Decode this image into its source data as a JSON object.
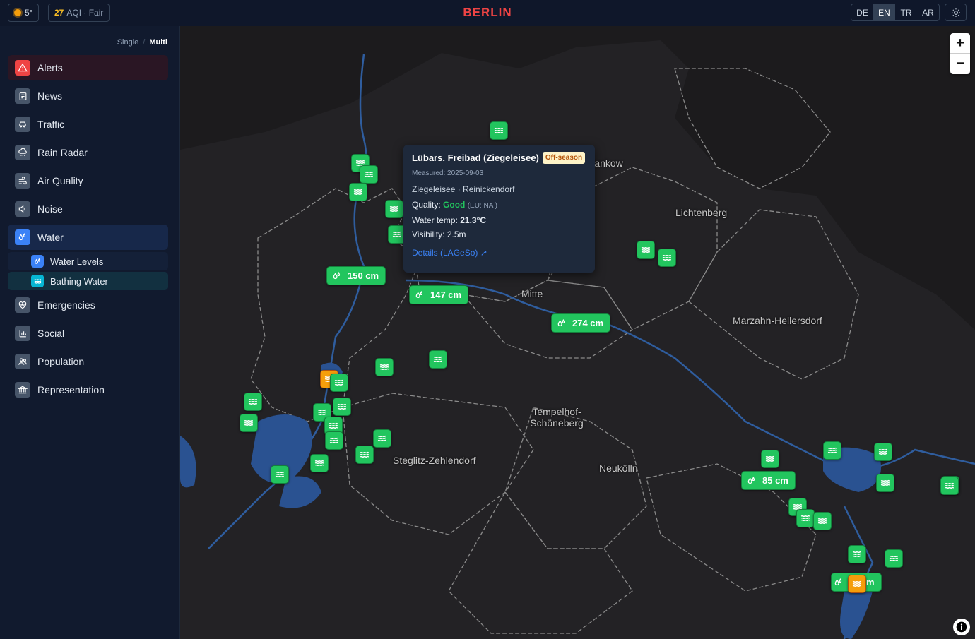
{
  "topbar": {
    "temperature": "5°",
    "aqi_value": "27",
    "aqi_label": "AQI · Fair",
    "city": "BERLIN",
    "languages": [
      "DE",
      "EN",
      "TR",
      "AR"
    ],
    "active_language": "EN"
  },
  "sidebar": {
    "mode_single": "Single",
    "mode_multi": "Multi",
    "items": [
      {
        "label": "Alerts",
        "icon": "warning-icon"
      },
      {
        "label": "News",
        "icon": "newspaper-icon"
      },
      {
        "label": "Traffic",
        "icon": "car-icon"
      },
      {
        "label": "Rain Radar",
        "icon": "cloud-rain-icon"
      },
      {
        "label": "Air Quality",
        "icon": "wind-icon"
      },
      {
        "label": "Noise",
        "icon": "speaker-icon"
      },
      {
        "label": "Water",
        "icon": "droplets-icon"
      },
      {
        "label": "Emergencies",
        "icon": "heart-pulse-icon"
      },
      {
        "label": "Social",
        "icon": "bar-chart-icon"
      },
      {
        "label": "Population",
        "icon": "users-icon"
      },
      {
        "label": "Representation",
        "icon": "landmark-icon"
      }
    ],
    "water_subitems": [
      {
        "label": "Water Levels",
        "icon": "droplets-icon"
      },
      {
        "label": "Bathing Water",
        "icon": "waves-icon"
      }
    ]
  },
  "map": {
    "districts": [
      "Pankow",
      "Lichtenberg",
      "Mitte",
      "Marzahn-Hellersdorf",
      "Tempelhof-Schöneberg",
      "Steglitz-Zehlendorf",
      "Neukölln"
    ],
    "water_levels": [
      "150 cm",
      "147 cm",
      "274 cm",
      "85 cm"
    ],
    "partial_level_text": "m"
  },
  "popup": {
    "title": "Lübars. Freibad (Ziegeleisee)",
    "badge": "Off-season",
    "measured": "Measured: 2025-09-03",
    "location": "Ziegeleisee · Reinickendorf",
    "quality_label": "Quality:",
    "quality_value": "Good",
    "quality_eu": "(EU: NA )",
    "water_temp_label": "Water temp:",
    "water_temp_value": "21.3°C",
    "visibility_label": "Visibility:",
    "visibility_value": "2.5m",
    "details_link": "Details (LAGeSo) ↗"
  },
  "colors": {
    "accent_red": "#ef4444",
    "water_blue": "#3b82f6",
    "marker_green": "#22c55e",
    "marker_orange": "#f59e0b"
  }
}
